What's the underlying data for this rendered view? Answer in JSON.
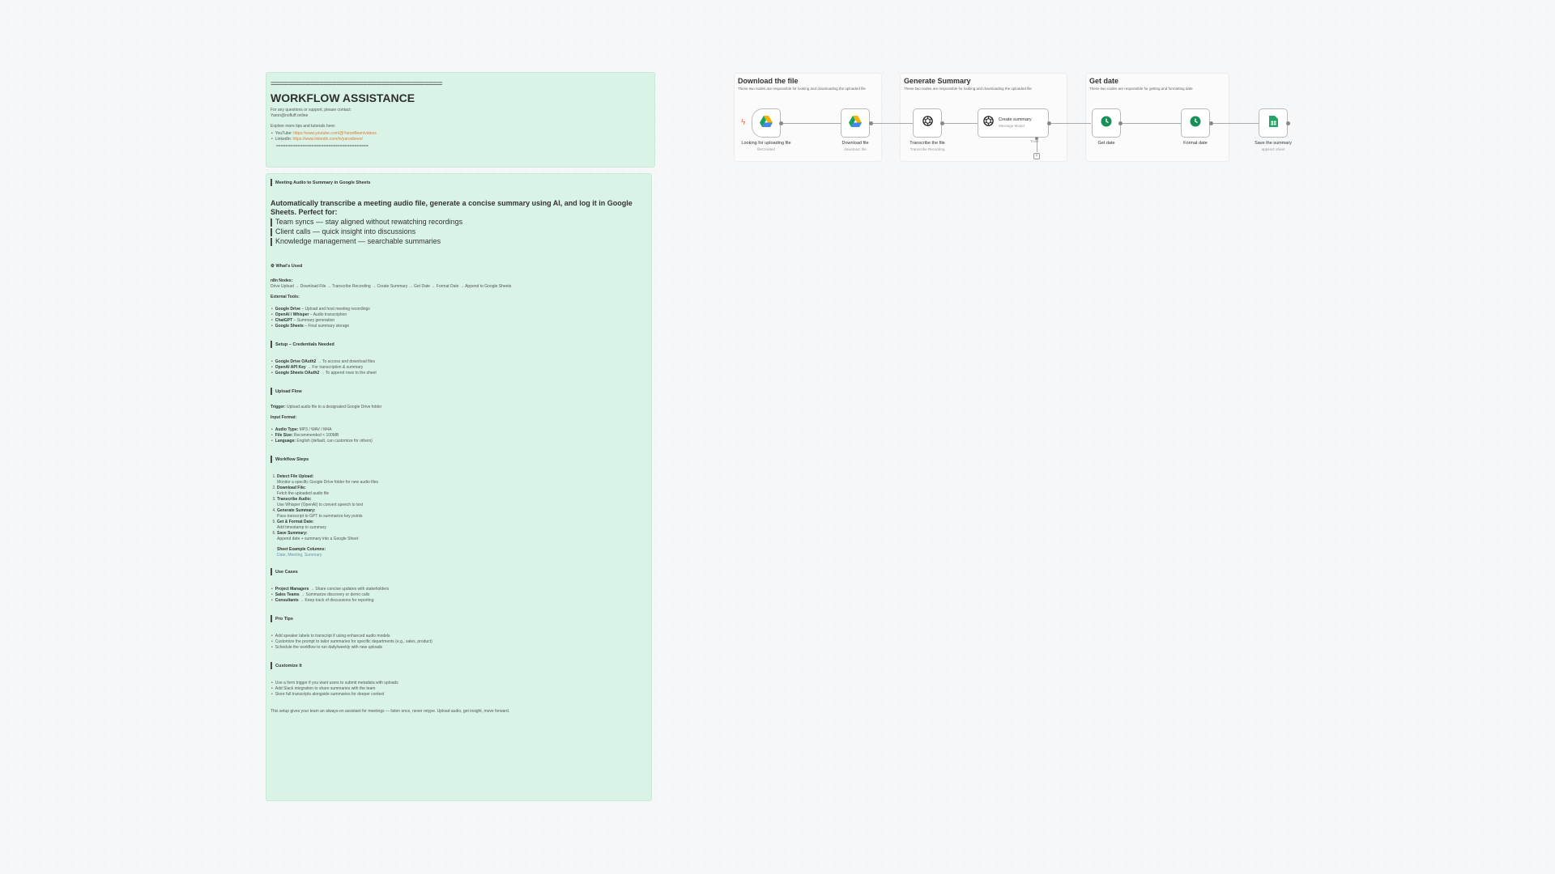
{
  "header_note": {
    "rule": "=======================================",
    "title": "WORKFLOW ASSISTANCE",
    "support_line": "For any questions or support, please contact:",
    "email": "Yaron@nofluff.online",
    "explore": "Explore more tips and tutorials here:",
    "youtube_label": "YouTube:",
    "youtube_url": "https://www.youtube.com/@YaronBeen/videos",
    "linkedin_label": "LinkedIn:",
    "linkedin_url": "https://www.linkedin.com/in/yaronbeen/",
    "rule_bottom": "======================================="
  },
  "main_note": {
    "heading": "Meeting Audio to Summary in Google Sheets",
    "intro": "Automatically transcribe a meeting audio file, generate a concise summary using AI, and log it in Google Sheets. Perfect for:",
    "perfect_for": [
      "Team syncs — stay aligned without rewatching recordings",
      "Client calls — quick insight into discussions",
      "Knowledge management — searchable summaries"
    ],
    "whats_used_heading": "⚙ What's Used",
    "n8n_nodes_label": "n8n Nodes:",
    "n8n_nodes_flow": "Drive Upload → Download File → Transcribe Recording → Create Summary → Get Date → Format Date → Append to Google Sheets",
    "external_tools_label": "External Tools:",
    "external_tools": [
      {
        "name": "Google Drive",
        "desc": " – Upload and host meeting recordings"
      },
      {
        "name": "OpenAI / Whisper",
        "desc": " – Audio transcription"
      },
      {
        "name": "ChatGPT",
        "desc": " – Summary generation"
      },
      {
        "name": "Google Sheets",
        "desc": " – Final summary storage"
      }
    ],
    "setup_heading": "Setup – Credentials Needed",
    "credentials": [
      {
        "name": "Google Drive OAuth2",
        "desc": " → To access and download files"
      },
      {
        "name": "OpenAI API Key",
        "desc": " → For transcription & summary"
      },
      {
        "name": "Google Sheets OAuth2",
        "desc": " → To append rows to the sheet"
      }
    ],
    "upload_heading": "Upload Flow",
    "trigger_label": "Trigger:",
    "trigger_text": " Upload audio file to a designated Google Drive folder",
    "input_format_label": "Input Format:",
    "input_format": [
      {
        "name": "Audio Type:",
        "desc": " MP3 / WAV / M4A"
      },
      {
        "name": "File Size:",
        "desc": " Recommended < 100MB"
      },
      {
        "name": "Language:",
        "desc": " English (default, can customize for others)"
      }
    ],
    "steps_heading": "Workflow Steps",
    "steps": [
      {
        "name": "Detect File Upload:",
        "desc": "Monitor a specific Google Drive folder for new audio files"
      },
      {
        "name": "Download File:",
        "desc": "Fetch the uploaded audio file"
      },
      {
        "name": "Transcribe Audio:",
        "desc": "Use Whisper (OpenAI) to convert speech to text"
      },
      {
        "name": "Generate Summary:",
        "desc": "Pass transcript to GPT to summarize key points"
      },
      {
        "name": "Get & Format Date:",
        "desc": "Add timestamp to summary"
      },
      {
        "name": "Save Summary:",
        "desc": "Append date + summary into a Google Sheet"
      }
    ],
    "sheet_columns_label": "Sheet Example Columns:",
    "sheet_columns": "Date, Meeting, Summary",
    "use_cases_heading": "Use Cases",
    "use_cases": [
      {
        "name": "Project Managers",
        "desc": " → Share concise updates with stakeholders"
      },
      {
        "name": "Sales Teams",
        "desc": " → Summarize discovery or demo calls"
      },
      {
        "name": "Consultants",
        "desc": " → Keep track of discussions for reporting"
      }
    ],
    "pro_tips_heading": "Pro Tips",
    "pro_tips": [
      "Add speaker labels to transcript if using enhanced audio models",
      "Customize the prompt to tailor summaries for specific departments (e.g., sales, product)",
      "Schedule the workflow to run daily/weekly with new uploads"
    ],
    "customize_heading": "Customize It",
    "customize": [
      "Use a form trigger if you want users to submit metadata with uploads",
      "Add Slack integration to share summaries with the team",
      "Store full transcripts alongside summaries for deeper context"
    ],
    "closing": "This setup gives your team an always-on assistant for meetings — listen once, never retype. Upload audio, get insight, move forward."
  },
  "groups": [
    {
      "title": "Download the file",
      "desc": "These two nodes are responsible for looking and downloading the uploaded file"
    },
    {
      "title": "Generate Summary",
      "desc": "These two nodes are responsible for looking and downloading the uploaded file"
    },
    {
      "title": "Get date",
      "desc": "These two nodes are responsible for getting and formatting date"
    }
  ],
  "nodes": [
    {
      "label": "Looking for uploading file",
      "sub": "fileCreated",
      "icon": "google-drive-icon"
    },
    {
      "label": "Download file",
      "sub": "download: file",
      "icon": "google-drive-icon"
    },
    {
      "label": "Transcribe the file",
      "sub": "Transcribe Recording",
      "icon": "openai-icon"
    },
    {
      "label": "Create summary",
      "sub": "Message Model",
      "icon": "openai-icon"
    },
    {
      "label": "Get date",
      "sub": "",
      "icon": "clock-icon"
    },
    {
      "label": "Format date",
      "sub": "",
      "icon": "clock-icon"
    },
    {
      "label": "Save the summary",
      "sub": "append: sheet",
      "icon": "google-sheets-icon"
    }
  ],
  "tools_label": "Tools",
  "colors": {
    "note_bg": "#d9f4e6",
    "link": "#e0763a",
    "clock": "#1a8f5a",
    "sheets": "#23a566",
    "trigger": "#ff6a3d"
  }
}
